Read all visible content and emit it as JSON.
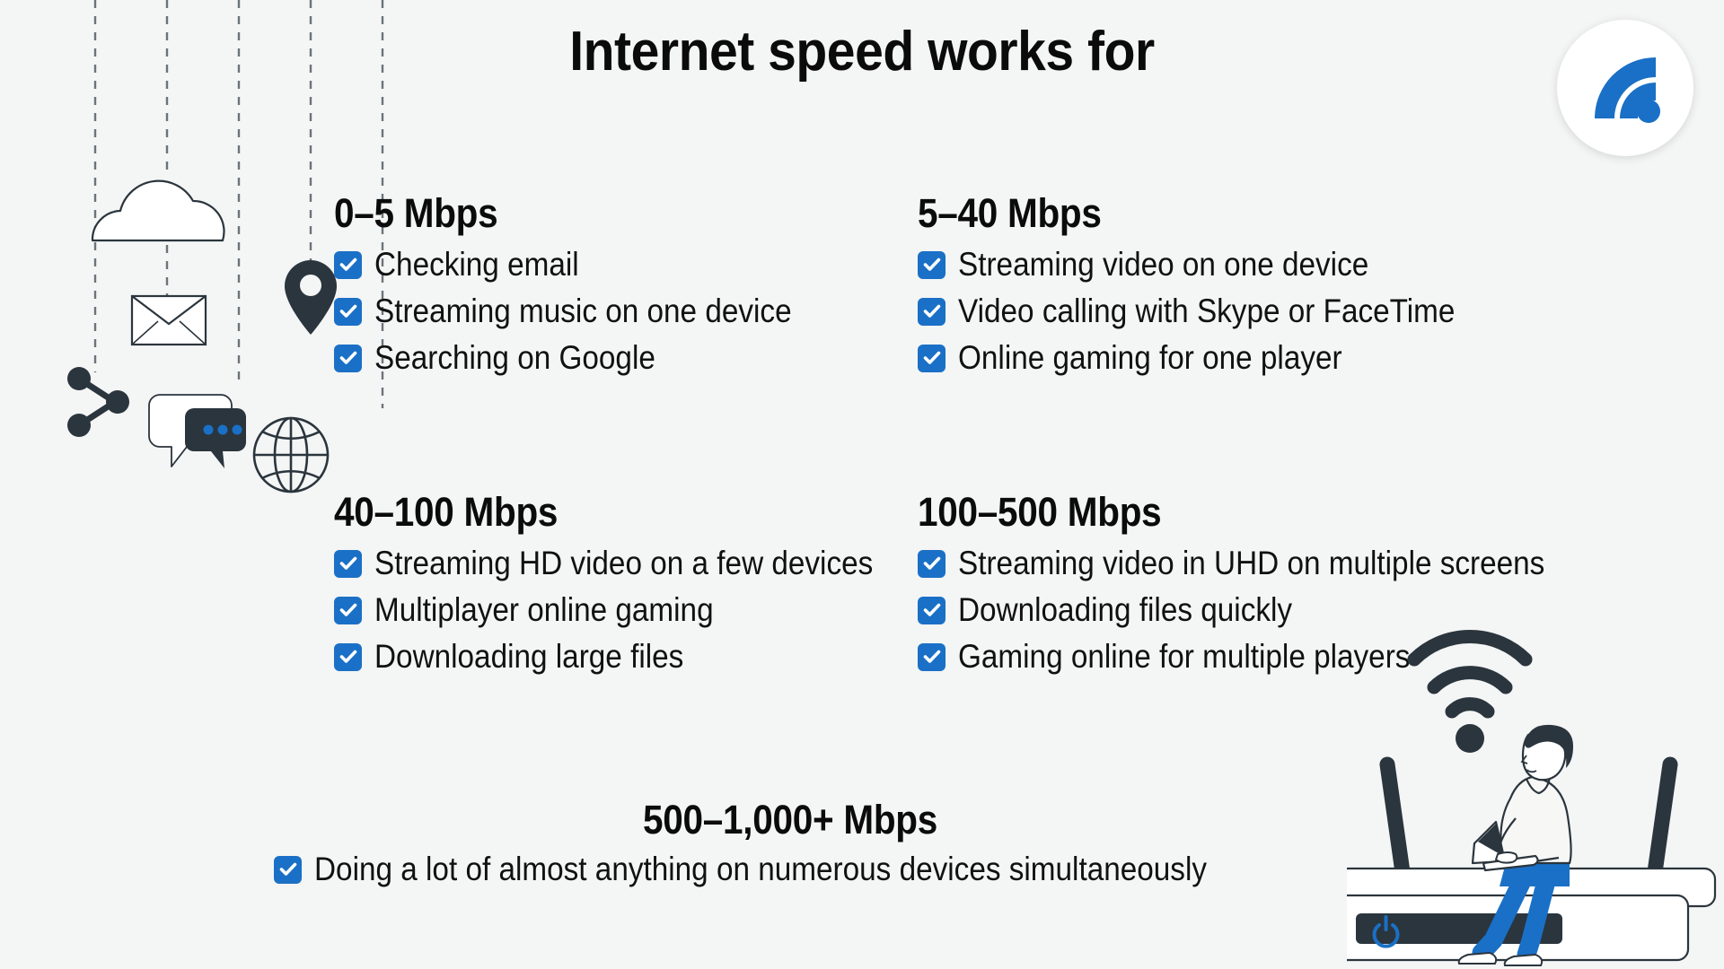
{
  "header": {
    "title": "Internet speed works for",
    "logo_icon": "wifi-signal-logo-icon",
    "logo_color": "#1a70c6"
  },
  "theme": {
    "background": "#f4f5f5",
    "accent_blue": "#1a70c6",
    "ink_dark": "#2b353d",
    "text_black": "#0b0b0b"
  },
  "tiers": [
    {
      "id": "tier-0",
      "heading": "0–5 Mbps",
      "items": [
        "Checking email",
        "Streaming music on one device",
        "Searching on Google"
      ]
    },
    {
      "id": "tier-1",
      "heading": "5–40 Mbps",
      "items": [
        "Streaming video on one device",
        "Video calling with Skype or FaceTime",
        "Online gaming for one player"
      ]
    },
    {
      "id": "tier-2",
      "heading": "40–100 Mbps",
      "items": [
        "Streaming HD video on a few devices",
        "Multiplayer online gaming",
        "Downloading large files"
      ]
    },
    {
      "id": "tier-3",
      "heading": "100–500 Mbps",
      "items": [
        "Streaming video in UHD on multiple screens",
        "Downloading files quickly",
        "Gaming online for multiple players"
      ]
    },
    {
      "id": "tier-4",
      "heading": "500–1,000+ Mbps",
      "items": [
        "Doing a lot of almost anything on numerous devices simultaneously"
      ]
    }
  ],
  "decorations": {
    "left_icons": [
      "cloud-icon",
      "envelope-icon",
      "location-pin-icon",
      "share-network-icon",
      "chat-bubbles-icon",
      "globe-icon"
    ],
    "right_illustration": [
      "wifi-signal-icon",
      "router-icon",
      "person-with-laptop-icon",
      "power-button-icon"
    ]
  }
}
